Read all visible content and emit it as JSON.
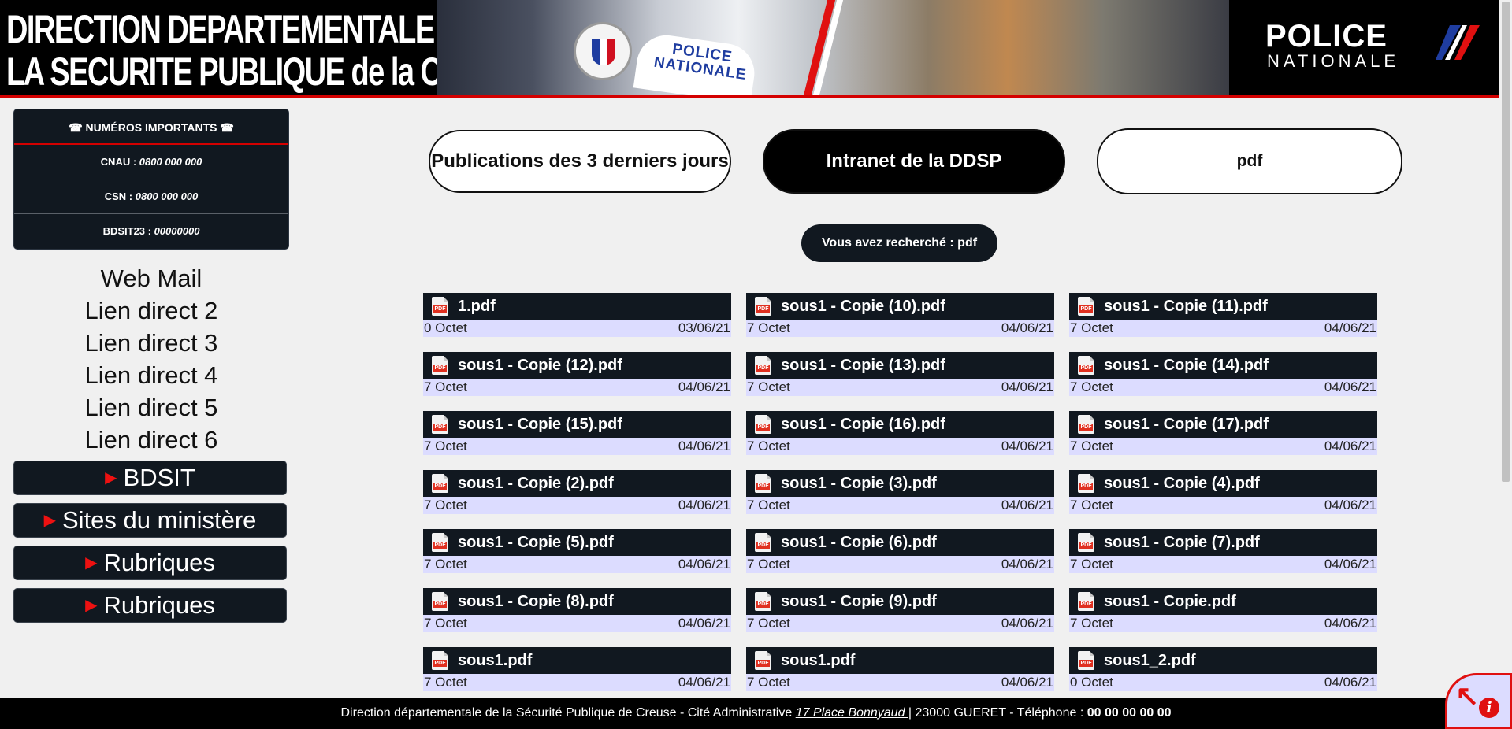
{
  "header": {
    "title_line1": "DIRECTION DEPARTEMENTALE DE",
    "title_line2": "LA SECURITE PUBLIQUE de la CREUSE",
    "logo_main": "POLICE",
    "logo_sub": "NATIONALE",
    "car_text_line1": "POLICE",
    "car_text_line2": "NATIONALE",
    "accent_color": "#d40000"
  },
  "important": {
    "title": "☎ NUMÉROS IMPORTANTS ☎",
    "rows": [
      {
        "label": "CNAU : ",
        "value": "0800 000 000"
      },
      {
        "label": "CSN : ",
        "value": "0800 000 000"
      },
      {
        "label": "BDSIT23 : ",
        "value": "00000000"
      }
    ]
  },
  "links": [
    "Web Mail",
    "Lien direct 2",
    "Lien direct 3",
    "Lien direct 4",
    "Lien direct 5",
    "Lien direct 6"
  ],
  "menus": [
    "BDSIT",
    "Sites du ministère",
    "Rubriques",
    "Rubriques"
  ],
  "buttons": {
    "publications": "Publications des 3 derniers jours",
    "intranet": "Intranet de la DDSP",
    "search_value": "pdf"
  },
  "search_result": "Vous avez recherché : pdf",
  "files": [
    {
      "name": "1.pdf",
      "size": "0 Octet",
      "date": "03/06/21"
    },
    {
      "name": "sous1 - Copie (10).pdf",
      "size": "7 Octet",
      "date": "04/06/21"
    },
    {
      "name": "sous1 - Copie (11).pdf",
      "size": "7 Octet",
      "date": "04/06/21"
    },
    {
      "name": "sous1 - Copie (12).pdf",
      "size": "7 Octet",
      "date": "04/06/21"
    },
    {
      "name": "sous1 - Copie (13).pdf",
      "size": "7 Octet",
      "date": "04/06/21"
    },
    {
      "name": "sous1 - Copie (14).pdf",
      "size": "7 Octet",
      "date": "04/06/21"
    },
    {
      "name": "sous1 - Copie (15).pdf",
      "size": "7 Octet",
      "date": "04/06/21"
    },
    {
      "name": "sous1 - Copie (16).pdf",
      "size": "7 Octet",
      "date": "04/06/21"
    },
    {
      "name": "sous1 - Copie (17).pdf",
      "size": "7 Octet",
      "date": "04/06/21"
    },
    {
      "name": "sous1 - Copie (2).pdf",
      "size": "7 Octet",
      "date": "04/06/21"
    },
    {
      "name": "sous1 - Copie (3).pdf",
      "size": "7 Octet",
      "date": "04/06/21"
    },
    {
      "name": "sous1 - Copie (4).pdf",
      "size": "7 Octet",
      "date": "04/06/21"
    },
    {
      "name": "sous1 - Copie (5).pdf",
      "size": "7 Octet",
      "date": "04/06/21"
    },
    {
      "name": "sous1 - Copie (6).pdf",
      "size": "7 Octet",
      "date": "04/06/21"
    },
    {
      "name": "sous1 - Copie (7).pdf",
      "size": "7 Octet",
      "date": "04/06/21"
    },
    {
      "name": "sous1 - Copie (8).pdf",
      "size": "7 Octet",
      "date": "04/06/21"
    },
    {
      "name": "sous1 - Copie (9).pdf",
      "size": "7 Octet",
      "date": "04/06/21"
    },
    {
      "name": "sous1 - Copie.pdf",
      "size": "7 Octet",
      "date": "04/06/21"
    },
    {
      "name": "sous1.pdf",
      "size": "7 Octet",
      "date": "04/06/21"
    },
    {
      "name": "sous1.pdf",
      "size": "7 Octet",
      "date": "04/06/21"
    },
    {
      "name": "sous1_2.pdf",
      "size": "0 Octet",
      "date": "04/06/21"
    }
  ],
  "pdf_icon_label": "PDF",
  "footer": {
    "text_before": "Direction départementale de la Sécurité Publique de Creuse - Cité Administrative ",
    "address_link": "17 Place Bonnyaud ",
    "text_after": "| 23000 GUERET - Téléphone : ",
    "phone": "00 00 00 00 00"
  },
  "help": {
    "arrow": "↖",
    "info": "i"
  }
}
